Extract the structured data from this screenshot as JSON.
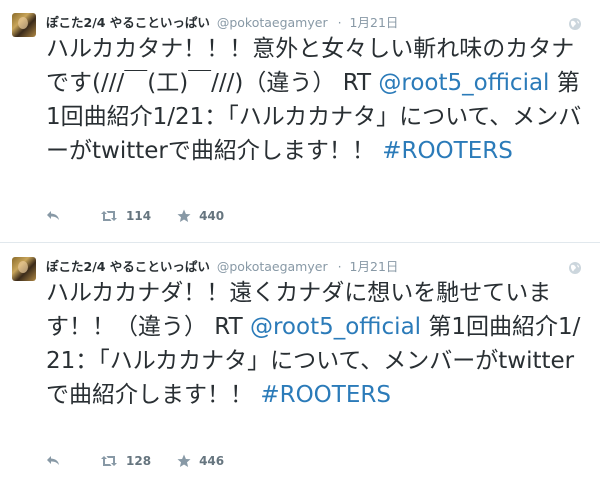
{
  "tweets": [
    {
      "fullname": "ぽこた2/4 やることいっぱい",
      "username": "@pokotaegamyer",
      "separator": "·",
      "time": "1月21日",
      "text_segments": [
        {
          "type": "text",
          "value": "ハルカカタナ！！！意外と女々しい斬れ味のカタナです(///￣(工)￣///)（違う） RT "
        },
        {
          "type": "link",
          "value": "@root5_official"
        },
        {
          "type": "text",
          "value": " 第1回曲紹介1/21：「ハルカカナタ」について、メンバーがtwitterで曲紹介します！！ "
        },
        {
          "type": "link",
          "value": "#ROOTERS"
        }
      ],
      "retweets": "114",
      "favorites": "440"
    },
    {
      "fullname": "ぽこた2/4 やることいっぱい",
      "username": "@pokotaegamyer",
      "separator": "·",
      "time": "1月21日",
      "text_segments": [
        {
          "type": "text",
          "value": "ハルカカナダ！！遠くカナダに想いを馳せています！！（違う） RT "
        },
        {
          "type": "link",
          "value": "@root5_official"
        },
        {
          "type": "text",
          "value": " 第1回曲紹介1/21：「ハルカカナタ」について、メンバーがtwitterで曲紹介します！！ "
        },
        {
          "type": "link",
          "value": "#ROOTERS"
        }
      ],
      "retweets": "128",
      "favorites": "446"
    }
  ],
  "icons": {
    "globe": "globe-icon",
    "reply": "reply-icon",
    "retweet": "retweet-icon",
    "favorite": "star-icon"
  },
  "colors": {
    "link": "#2b7bb9",
    "muted": "#8899a6",
    "text": "#292f33",
    "divider": "#e1e8ed"
  }
}
